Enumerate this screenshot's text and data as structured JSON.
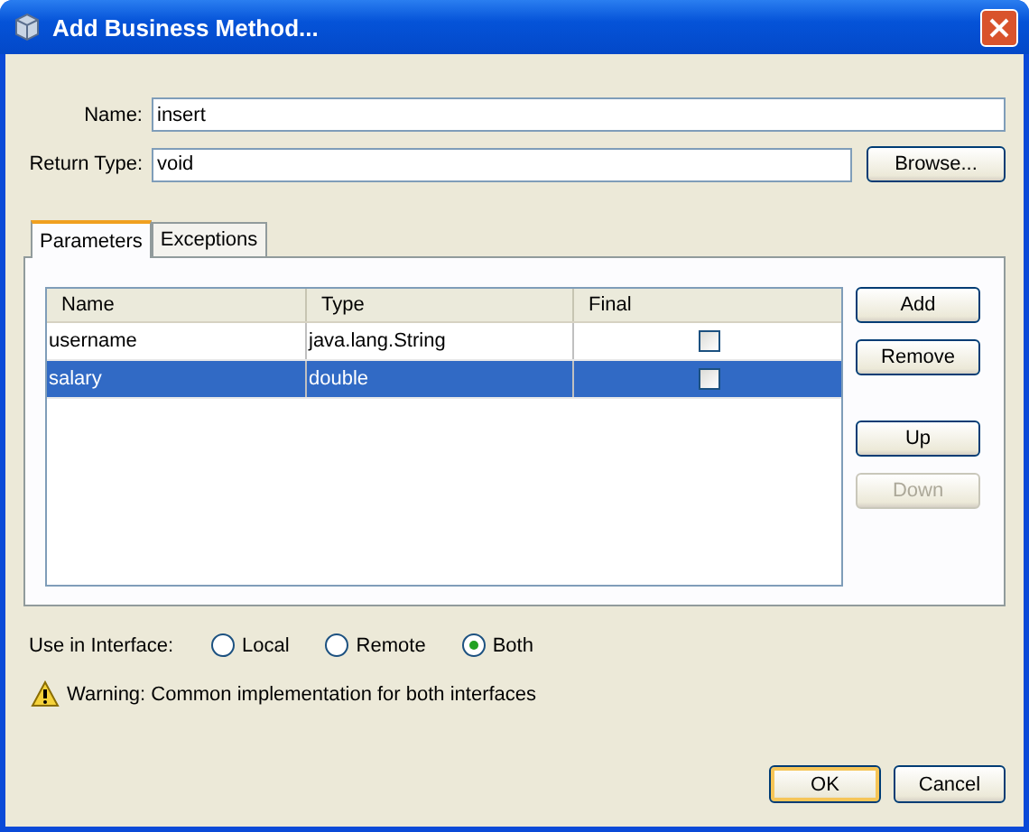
{
  "window": {
    "title": "Add Business Method..."
  },
  "fields": [
    {
      "label": "Name:",
      "value": "insert"
    },
    {
      "label": "Return Type:",
      "value": "void",
      "button": "Browse..."
    }
  ],
  "tabs": [
    {
      "label": "Parameters",
      "selected": true
    },
    {
      "label": "Exceptions",
      "selected": false
    }
  ],
  "table": {
    "columns": [
      "Name",
      "Type",
      "Final"
    ],
    "rows": [
      {
        "name": "username",
        "type": "java.lang.String",
        "final": false,
        "selected": false
      },
      {
        "name": "salary",
        "type": "double",
        "final": false,
        "selected": true
      }
    ]
  },
  "side_buttons": [
    {
      "label": "Add",
      "disabled": false
    },
    {
      "label": "Remove",
      "disabled": false
    },
    {
      "label": "Up",
      "disabled": false
    },
    {
      "label": "Down",
      "disabled": true
    }
  ],
  "interface": {
    "label": "Use in Interface:",
    "options": [
      {
        "label": "Local",
        "selected": false
      },
      {
        "label": "Remote",
        "selected": false
      },
      {
        "label": "Both",
        "selected": true
      }
    ]
  },
  "warning": "Warning: Common implementation for both interfaces",
  "buttons": [
    {
      "label": "OK",
      "default": true
    },
    {
      "label": "Cancel",
      "default": false
    }
  ]
}
